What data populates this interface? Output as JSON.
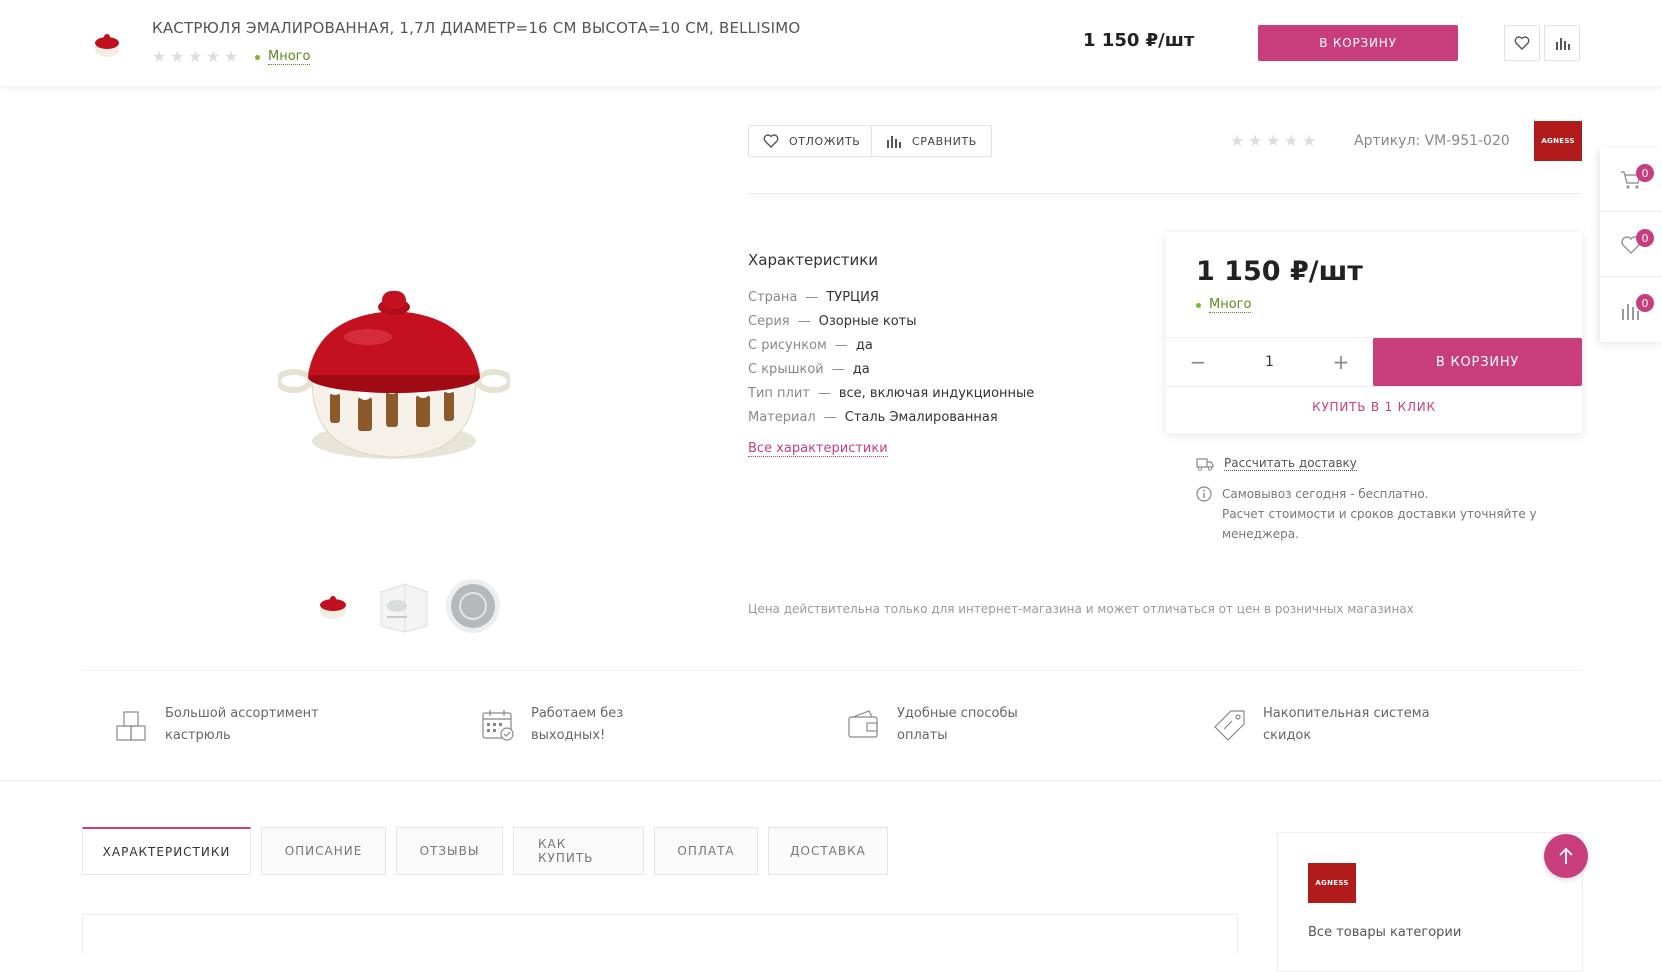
{
  "sticky_header": {
    "title": "КАСТРЮЛЯ ЭМАЛИРОВАННАЯ, 1,7Л ДИАМЕТР=16 СМ ВЫСОТА=10 СМ, BELLISIMO",
    "availability": "Много",
    "price": "1 150 ₽/шт",
    "cart_button": "В КОРЗИНУ",
    "fav_icon": "heart-icon",
    "compare_icon": "bar-chart-icon"
  },
  "side_panel": {
    "cart_count": "0",
    "fav_count": "0",
    "compare_count": "0"
  },
  "product": {
    "later_button": "ОТЛОЖИТЬ",
    "compare_button": "СРАВНИТЬ",
    "article": "Артикул: VM-951-020",
    "brand": "AGNESS",
    "characteristics_title": "Характеристики",
    "characteristics": [
      {
        "key": "Страна",
        "value": "ТУРЦИЯ"
      },
      {
        "key": "Серия",
        "value": "Озорные коты"
      },
      {
        "key": "С рисунком",
        "value": "да"
      },
      {
        "key": "С крышкой",
        "value": "да"
      },
      {
        "key": "Тип плит",
        "value": "все, включая индукционные"
      },
      {
        "key": "Материал",
        "value": "Сталь Эмалированная"
      }
    ],
    "all_characteristics_link": "Все характеристики",
    "disclaimer": "Цена действительна только для интернет-магазина и может отличаться от цен в розничных магазинах"
  },
  "buy_box": {
    "price": "1 150 ₽/шт",
    "availability": "Много",
    "quantity": "1",
    "minus": "−",
    "plus": "+",
    "cart_button": "В КОРЗИНУ",
    "one_click": "КУПИТЬ В 1 КЛИК",
    "delivery_link": "Рассчитать доставку",
    "pickup_line1": "Самовывоз сегодня - бесплатно.",
    "pickup_line2": "Расчет стоимости и сроков доставки уточняйте у менеджера."
  },
  "features": [
    {
      "line1": "Большой ассортимент",
      "line2": "кастрюль"
    },
    {
      "line1": "Работаем без",
      "line2": "выходных!"
    },
    {
      "line1": "Удобные способы",
      "line2": "оплаты"
    },
    {
      "line1": "Накопительная система",
      "line2": "скидок"
    }
  ],
  "tabs": [
    "ХАРАКТЕРИСТИКИ",
    "ОПИСАНИЕ",
    "ОТЗЫВЫ",
    "КАК КУПИТЬ",
    "ОПЛАТА",
    "ДОСТАВКА"
  ],
  "brand_card": {
    "brand": "AGNESS",
    "text": "Все товары категории"
  },
  "colors": {
    "accent": "#c83e7d",
    "availability": "#7ab52a",
    "brand_red": "#b21b1b"
  }
}
